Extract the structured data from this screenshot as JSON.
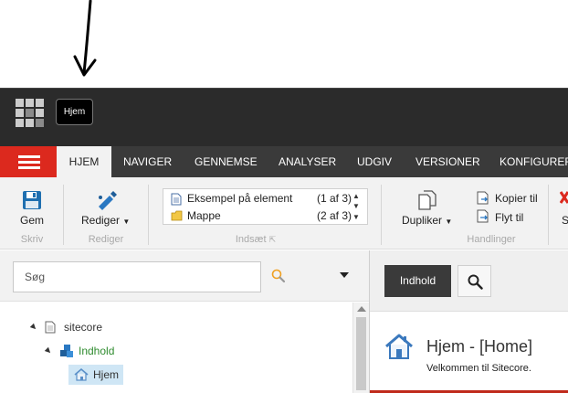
{
  "topbar": {
    "home_button_label": "Hjem"
  },
  "tabs": [
    {
      "label": "HJEM",
      "active": true
    },
    {
      "label": "NAVIGER",
      "active": false
    },
    {
      "label": "GENNEMSE",
      "active": false
    },
    {
      "label": "ANALYSER",
      "active": false
    },
    {
      "label": "UDGIV",
      "active": false
    },
    {
      "label": "VERSIONER",
      "active": false
    },
    {
      "label": "KONFIGURER",
      "active": false
    }
  ],
  "ribbon": {
    "save_label": "Gem",
    "write_group": "Skriv",
    "edit_label": "Rediger",
    "edit_group": "Rediger",
    "insert_items": [
      {
        "name": "Eksempel på element",
        "count": "(1 af 3)"
      },
      {
        "name": "Mappe",
        "count": "(2 af 3)"
      }
    ],
    "insert_group": "Indsæt",
    "duplicate_label": "Dupliker",
    "copy_to_label": "Kopier til",
    "move_to_label": "Flyt til",
    "actions_group": "Handlinger",
    "cut_off_label": "S"
  },
  "search": {
    "placeholder": "Søg"
  },
  "tree": {
    "nodes": [
      {
        "label": "sitecore"
      },
      {
        "label": "Indhold"
      },
      {
        "label": "Hjem"
      }
    ]
  },
  "content": {
    "tab_label": "Indhold",
    "title": "Hjem - [Home]",
    "subtitle": "Velkommen til Sitecore."
  },
  "colors": {
    "accent_red": "#dc291e",
    "dark_bar": "#2b2b2b",
    "tab_bar": "#3a3a3a",
    "ribbon_bg": "#f2f2f2",
    "tree_green": "#2e8b2e"
  }
}
